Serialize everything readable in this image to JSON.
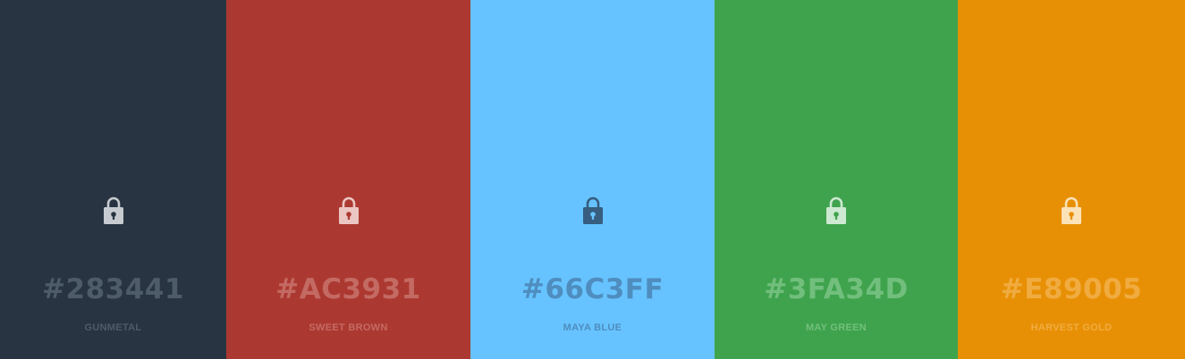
{
  "palette": {
    "swatches": [
      {
        "hex": "#283441",
        "name": "GUNMETAL",
        "background": "#283441",
        "text_color": "#4e5b68",
        "icon": "lock-icon",
        "icon_fill": "#c7cbd0",
        "icon_hole": "#283441"
      },
      {
        "hex": "#AC3931",
        "name": "SWEET BROWN",
        "background": "#ac3931",
        "text_color": "#c36a63",
        "icon": "lock-icon",
        "icon_fill": "#ebc6c3",
        "icon_hole": "#ac3931"
      },
      {
        "hex": "#66C3FF",
        "name": "MAYA BLUE",
        "background": "#66c3ff",
        "text_color": "#4f8dbf",
        "icon": "lock-icon",
        "icon_fill": "#375d7f",
        "icon_hole": "#66c3ff"
      },
      {
        "hex": "#3FA34D",
        "name": "MAY GREEN",
        "background": "#3fa34d",
        "text_color": "#72bf7d",
        "icon": "lock-icon",
        "icon_fill": "#cde9d1",
        "icon_hole": "#3fa34d"
      },
      {
        "hex": "#E89005",
        "name": "HARVEST GOLD",
        "background": "#e89005",
        "text_color": "#f0ac41",
        "icon": "lock-icon",
        "icon_fill": "#fbe2b8",
        "icon_hole": "#e89005"
      }
    ]
  }
}
